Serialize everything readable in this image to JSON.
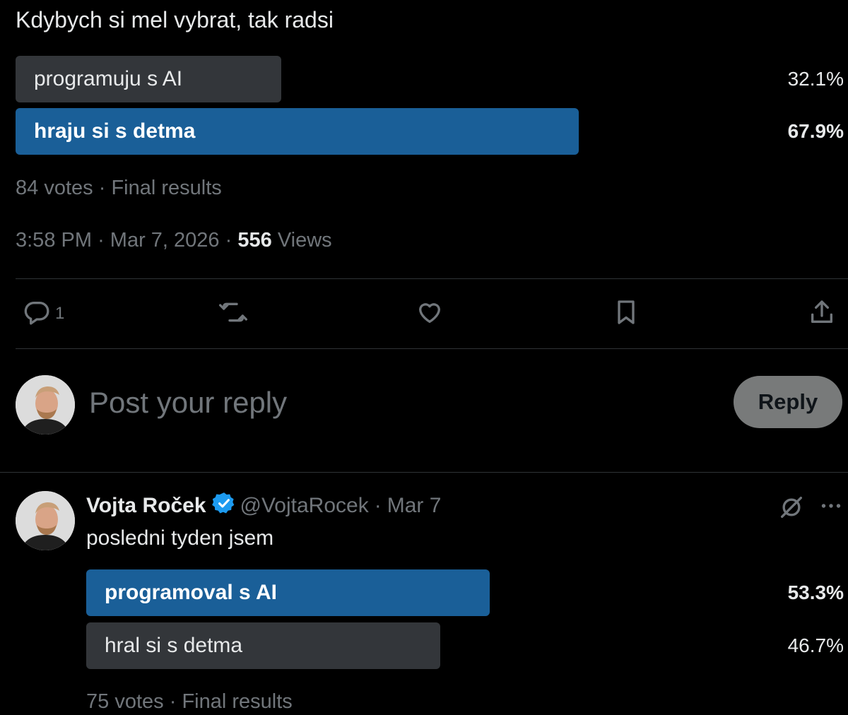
{
  "main_post": {
    "text": "Kdybych si mel vybrat, tak radsi",
    "poll": {
      "options": [
        {
          "label": "programuju s AI",
          "percent": "32.1%",
          "value": 32.1,
          "winner": false
        },
        {
          "label": "hraju si s detma",
          "percent": "67.9%",
          "value": 67.9,
          "winner": true
        }
      ],
      "votes": "84 votes",
      "separator": "·",
      "status": "Final results"
    },
    "time": "3:58 PM",
    "date": "Mar 7, 2026",
    "views_count": "556",
    "views_label": "Views"
  },
  "actions": {
    "reply_count": "1"
  },
  "composer": {
    "placeholder": "Post your reply",
    "button_label": "Reply"
  },
  "reply_post": {
    "author_name": "Vojta Roček",
    "handle": "@VojtaRocek",
    "separator": "·",
    "date": "Mar 7",
    "text": "posledni tyden jsem",
    "poll": {
      "options": [
        {
          "label": "programoval s AI",
          "percent": "53.3%",
          "value": 53.3,
          "winner": true
        },
        {
          "label": "hral si s detma",
          "percent": "46.7%",
          "value": 46.7,
          "winner": false
        }
      ],
      "votes": "75 votes",
      "separator": "·",
      "status": "Final results"
    }
  },
  "colors": {
    "background": "#000000",
    "winner_bar": "#1a5f98",
    "loser_bar": "#33363a",
    "muted_text": "#71767b",
    "primary_text": "#e7e9ea",
    "verified_badge": "#1d9bf0"
  },
  "icons": [
    "reply-icon",
    "repost-icon",
    "like-icon",
    "bookmark-icon",
    "share-icon",
    "grok-icon",
    "more-icon",
    "verified-icon"
  ]
}
